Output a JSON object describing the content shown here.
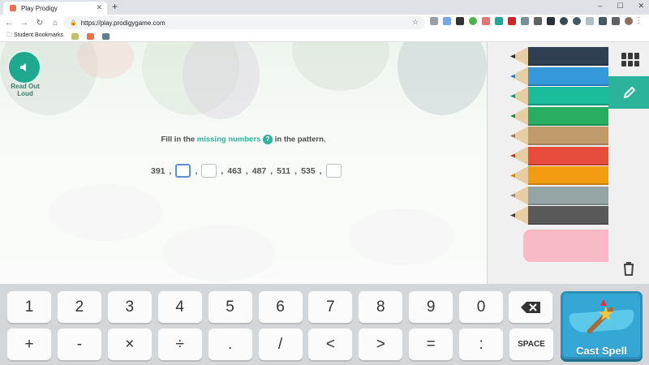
{
  "browser": {
    "tab_title": "Play Prodigy",
    "url": "https://play.prodigygame.com",
    "new_tab_label": "+",
    "bookmarks": [
      "Student Bookmarks"
    ],
    "window_controls": [
      "–",
      "☐",
      "✕"
    ]
  },
  "game": {
    "read_out_label": "Read Out Loud",
    "question": {
      "prefix": "Fill in the ",
      "highlight": "missing numbers",
      "suffix": " in the pattern."
    },
    "pattern": [
      {
        "type": "number",
        "value": "391"
      },
      {
        "type": "sep",
        "value": ","
      },
      {
        "type": "blank",
        "active": true
      },
      {
        "type": "sep",
        "value": ","
      },
      {
        "type": "blank",
        "active": false
      },
      {
        "type": "sep",
        "value": ","
      },
      {
        "type": "number",
        "value": "463"
      },
      {
        "type": "sep",
        "value": ","
      },
      {
        "type": "number",
        "value": "487"
      },
      {
        "type": "sep",
        "value": ","
      },
      {
        "type": "number",
        "value": "511"
      },
      {
        "type": "sep",
        "value": ","
      },
      {
        "type": "number",
        "value": "535"
      },
      {
        "type": "sep",
        "value": ","
      },
      {
        "type": "blank",
        "active": false
      }
    ]
  },
  "pencils": [
    {
      "color": "#2f3e52",
      "lead": "#1f2a38"
    },
    {
      "color": "#3498db",
      "lead": "#2a7fc0"
    },
    {
      "color": "#1abc9c",
      "lead": "#14967c"
    },
    {
      "color": "#27ae60",
      "lead": "#1e8c4c"
    },
    {
      "color": "#c19a6b",
      "lead": "#9c7a50"
    },
    {
      "color": "#e74c3c",
      "lead": "#c0392b"
    },
    {
      "color": "#f39c12",
      "lead": "#d4860a"
    },
    {
      "color": "#95a5a6",
      "lead": "#7f8c8d"
    },
    {
      "color": "#595959",
      "lead": "#3e3e3e"
    }
  ],
  "keypad": {
    "row1": [
      "1",
      "2",
      "3",
      "4",
      "5",
      "6",
      "7",
      "8",
      "9",
      "0"
    ],
    "row2": [
      "+",
      "-",
      "×",
      "÷",
      ".",
      "/",
      "<",
      ">",
      "=",
      ":",
      "SPACE"
    ],
    "cast_spell_label": "Cast Spell"
  },
  "colors": {
    "accent": "#2bb39b",
    "cast_spell": "#34a7d4"
  }
}
